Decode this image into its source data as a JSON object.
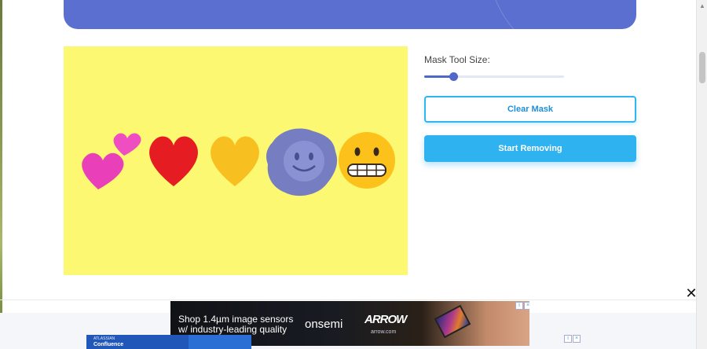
{
  "mask_tool": {
    "label": "Mask Tool Size:",
    "value_fraction": 0.21
  },
  "buttons": {
    "clear_mask": "Clear Mask",
    "start_removing": "Start Removing"
  },
  "canvas": {
    "background_color": "#fdf871",
    "emojis": [
      "two-hearts-emoji",
      "red-heart-emoji",
      "yellow-heart-emoji",
      "smiling-face-emoji",
      "grimacing-face-emoji"
    ],
    "mask_color": "#6a72c8"
  },
  "ad": {
    "line1": "Shop 1.4µm image sensors",
    "line2": "w/ industry-leading quality",
    "brand1": "onsemi",
    "brand2": "ARROW",
    "url": "arrow.com"
  },
  "ad_secondary": {
    "small_text": "ATLASSIAN",
    "main_text": "Confluence"
  },
  "colors": {
    "accent": "#2fb2f0",
    "banner": "#5b6fd0",
    "slider": "#4f67c8"
  }
}
